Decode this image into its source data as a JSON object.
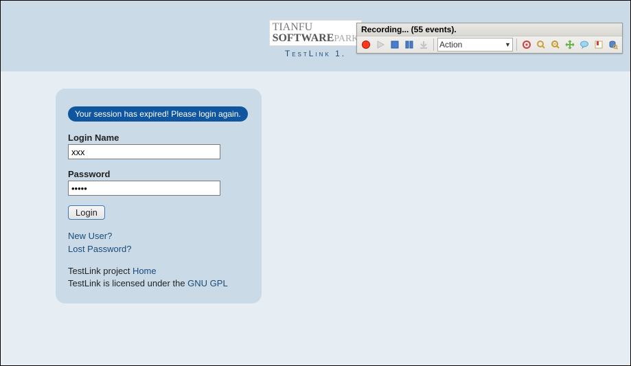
{
  "header": {
    "logo_line1": "TIANFU",
    "logo_line2_bold": "SOFTWARE",
    "logo_line2_grey": "PARK",
    "testlink_title": "TestLink 1."
  },
  "login_panel": {
    "session_message": "Your session has expired! Please login again.",
    "login_name_label": "Login Name",
    "login_name_value": "xxx",
    "password_label": "Password",
    "password_value": "•••••",
    "login_button": "Login",
    "new_user_link": "New User?",
    "lost_password_link": "Lost Password?",
    "footer_line1_prefix": "TestLink project ",
    "footer_line1_link": "Home",
    "footer_line2_prefix": "TestLink is licensed under the ",
    "footer_line2_link": "GNU GPL"
  },
  "recorder": {
    "title": "Recording... (55 events).",
    "action_dropdown": "Action"
  }
}
